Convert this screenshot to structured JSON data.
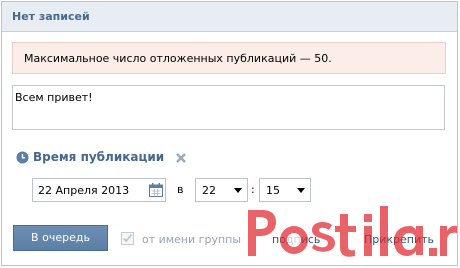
{
  "header": {
    "title": "Нет записей"
  },
  "warning": {
    "text": "Максимальное число отложенных публикаций — 50."
  },
  "post": {
    "text": "Всем привет!"
  },
  "schedule": {
    "title": "Время публикации",
    "date": "22 Апреля 2013",
    "at_label": "в",
    "hour": "22",
    "separator": ":",
    "minute": "15"
  },
  "footer": {
    "queue_label": "В очередь",
    "group_label": "от имени группы",
    "sign_label": "подпись",
    "attach_label": "Прикрепить"
  },
  "watermark": {
    "text": "Postila.ru"
  },
  "colors": {
    "accent": "#45688e",
    "button": "#5b7fa6",
    "warning_bg": "#fbeee9",
    "watermark": "#e0272e"
  },
  "icons": [
    "clock-icon",
    "close-icon",
    "calendar-icon",
    "chevron-down-icon",
    "checkbox-icon",
    "watermark-logo"
  ]
}
